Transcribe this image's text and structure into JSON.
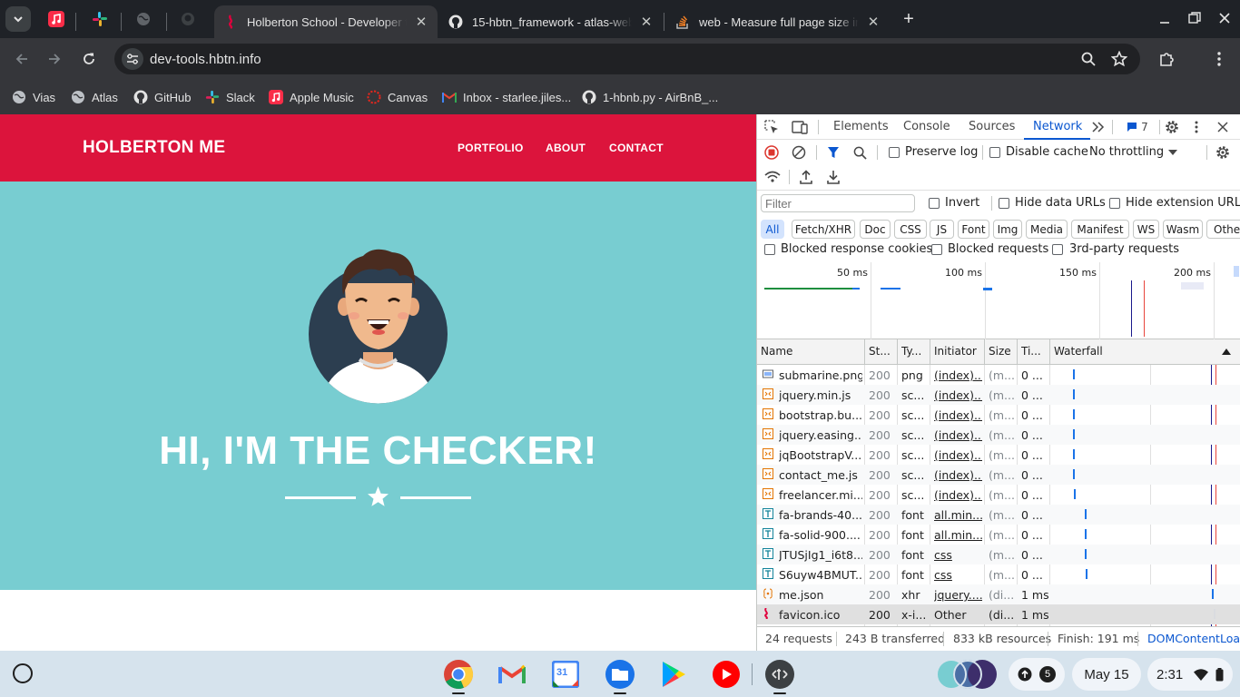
{
  "tabs": [
    {
      "title": "Holberton School - Developer to",
      "active": true
    },
    {
      "title": "15-hbtn_framework - atlas-web",
      "active": false
    },
    {
      "title": "web - Measure full page size in",
      "active": false
    }
  ],
  "pinned_tabs": [
    "apple-music",
    "slack",
    "generic-globe",
    "github"
  ],
  "address": {
    "url": "dev-tools.hbtn.info"
  },
  "bookmarks": [
    {
      "label": "Vias",
      "icon": "globe-icon"
    },
    {
      "label": "Atlas",
      "icon": "globe-icon"
    },
    {
      "label": "GitHub",
      "icon": "github-icon"
    },
    {
      "label": "Slack",
      "icon": "slack-icon"
    },
    {
      "label": "Apple Music",
      "icon": "apple-music-icon"
    },
    {
      "label": "Canvas",
      "icon": "canvas-icon"
    },
    {
      "label": "Inbox - starlee.jiles...",
      "icon": "gmail-icon"
    },
    {
      "label": "1-hbnb.py - AirBnB_...",
      "icon": "github-icon"
    }
  ],
  "site": {
    "brand": "HOLBERTON ME",
    "nav": [
      "PORTFOLIO",
      "ABOUT",
      "CONTACT"
    ],
    "headline": "HI, I'M THE CHECKER!",
    "colors": {
      "navbar": "#dc143c",
      "masthead": "#78cdd1"
    }
  },
  "devtools": {
    "tabs": [
      "Elements",
      "Console",
      "Sources",
      "Network"
    ],
    "active_tab": "Network",
    "issues_count": "7",
    "toolbar": {
      "preserve_log": "Preserve log",
      "disable_cache": "Disable cache",
      "throttling": "No throttling"
    },
    "filter": {
      "placeholder": "Filter",
      "invert": "Invert",
      "hide_data_urls": "Hide data URLs",
      "hide_extension_urls": "Hide extension URLs"
    },
    "type_filters": [
      "All",
      "Fetch/XHR",
      "Doc",
      "CSS",
      "JS",
      "Font",
      "Img",
      "Media",
      "Manifest",
      "WS",
      "Wasm",
      "Other"
    ],
    "active_type_filter": "All",
    "blocked": {
      "cookies": "Blocked response cookies",
      "requests": "Blocked requests",
      "third_party": "3rd-party requests"
    },
    "overview_ticks": [
      "50 ms",
      "100 ms",
      "150 ms",
      "200 ms"
    ],
    "columns": [
      "Name",
      "St...",
      "Ty...",
      "Initiator",
      "Size",
      "Ti...",
      "Waterfall"
    ],
    "requests": [
      {
        "name": "submarine.png",
        "status": "200",
        "type": "png",
        "initiator": "(index)...",
        "size": "(m...",
        "time": "0 ...",
        "icon": "image-icon",
        "wf": 0.12
      },
      {
        "name": "jquery.min.js",
        "status": "200",
        "type": "sc...",
        "initiator": "(index)...",
        "size": "(m...",
        "time": "0 ...",
        "icon": "script-icon",
        "wf": 0.12
      },
      {
        "name": "bootstrap.bu...",
        "status": "200",
        "type": "sc...",
        "initiator": "(index)...",
        "size": "(m...",
        "time": "0 ...",
        "icon": "script-icon",
        "wf": 0.12
      },
      {
        "name": "jquery.easing....",
        "status": "200",
        "type": "sc...",
        "initiator": "(index)...",
        "size": "(m...",
        "time": "0 ...",
        "icon": "script-icon",
        "wf": 0.12
      },
      {
        "name": "jqBootstrapV...",
        "status": "200",
        "type": "sc...",
        "initiator": "(index)...",
        "size": "(m...",
        "time": "0 ...",
        "icon": "script-icon",
        "wf": 0.12
      },
      {
        "name": "contact_me.js",
        "status": "200",
        "type": "sc...",
        "initiator": "(index)...",
        "size": "(m...",
        "time": "0 ...",
        "icon": "script-icon",
        "wf": 0.12
      },
      {
        "name": "freelancer.mi...",
        "status": "200",
        "type": "sc...",
        "initiator": "(index)...",
        "size": "(m...",
        "time": "0 ...",
        "icon": "script-icon",
        "wf": 0.125
      },
      {
        "name": "fa-brands-40...",
        "status": "200",
        "type": "font",
        "initiator": "all.min....",
        "size": "(m...",
        "time": "0 ...",
        "icon": "font-icon",
        "wf": 0.195
      },
      {
        "name": "fa-solid-900....",
        "status": "200",
        "type": "font",
        "initiator": "all.min....",
        "size": "(m...",
        "time": "0 ...",
        "icon": "font-icon",
        "wf": 0.195
      },
      {
        "name": "JTUSjIg1_i6t8...",
        "status": "200",
        "type": "font",
        "initiator": "css",
        "size": "(m...",
        "time": "0 ...",
        "icon": "font-icon",
        "wf": 0.195
      },
      {
        "name": "S6uyw4BMUT...",
        "status": "200",
        "type": "font",
        "initiator": "css",
        "size": "(m...",
        "time": "0 ...",
        "icon": "font-icon",
        "wf": 0.197
      },
      {
        "name": "me.json",
        "status": "200",
        "type": "xhr",
        "initiator": "jquery....",
        "size": "(di...",
        "time": "1 ms",
        "icon": "xhr-icon",
        "wf": 0.99
      },
      {
        "name": "favicon.ico",
        "status": "200",
        "type": "x-i...",
        "initiator": "Other",
        "size": "(di...",
        "time": "1 ms",
        "icon": "favicon-icon",
        "wf": 1.0
      }
    ],
    "status": {
      "requests": "24 requests",
      "transferred": "243 B transferred",
      "resources": "833 kB resources",
      "finish": "Finish: 191 ms",
      "domcontent": "DOMContentLoad"
    }
  },
  "shelf": {
    "apps": [
      "chrome-icon",
      "gmail-icon",
      "calendar-icon",
      "files-icon",
      "play-store-icon",
      "youtube-icon",
      "terminal-icon"
    ],
    "calendar_day": "31",
    "notification_count": "5",
    "date": "May 15",
    "time": "2:31"
  }
}
